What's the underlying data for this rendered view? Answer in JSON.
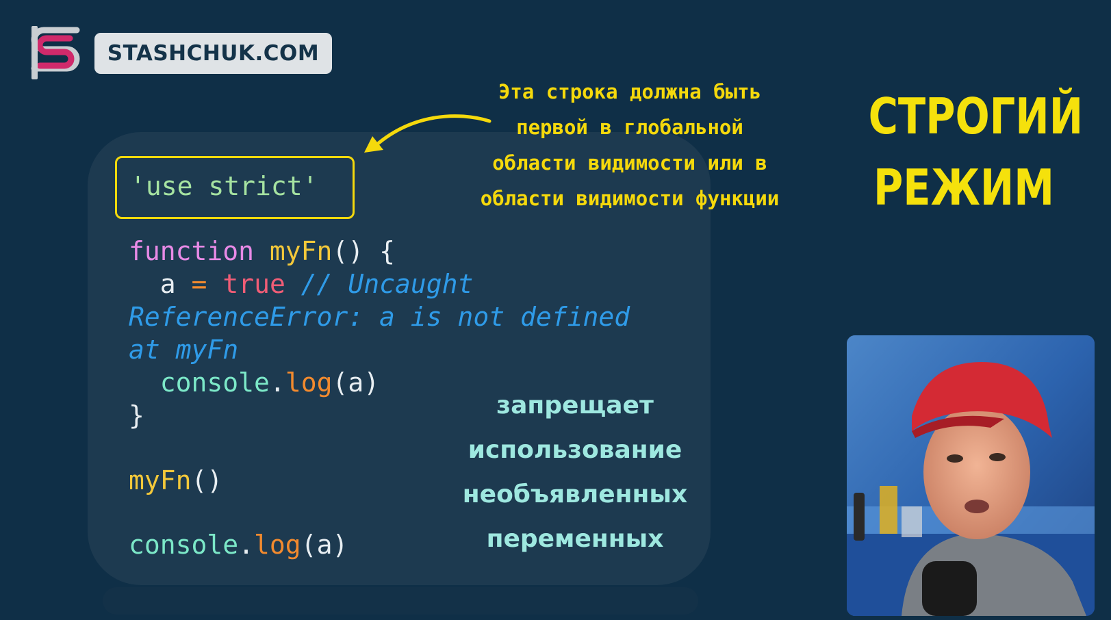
{
  "brand": {
    "logo_letter": "S",
    "site_name": "STASHCHUK.COM"
  },
  "title": {
    "line1": "СТРОГИЙ",
    "line2": "РЕЖИМ"
  },
  "note_top": {
    "line1": "Эта строка должна быть",
    "line2": "первой в глобальной",
    "line3": "области видимости или в",
    "line4": "области видимости функции"
  },
  "note_bottom": {
    "line1": "запрещает",
    "line2": "использование",
    "line3": "необъявленных",
    "line4": "переменных"
  },
  "code": {
    "use_strict": "'use strict'",
    "kw_function": "function",
    "fn_name": "myFn",
    "fn_parens_brace": "() {",
    "var_a": "a",
    "op_eq": "=",
    "bool_true": "true",
    "comment_1": "// Uncaught",
    "comment_2": "ReferenceError: a is not defined",
    "comment_3": "at myFn",
    "console_1": "console",
    "dot_1": ".",
    "log_1": "log",
    "args_1": "(a)",
    "close_brace": "}",
    "call_name": "myFn",
    "call_parens": "()",
    "console_2": "console",
    "dot_2": ".",
    "log_2": "log",
    "args_2": "(a)"
  },
  "colors": {
    "background": "#0f2f47",
    "panel": "#1d3a50",
    "accent_yellow": "#f5d90c",
    "brand_pink": "#d02a6b"
  }
}
